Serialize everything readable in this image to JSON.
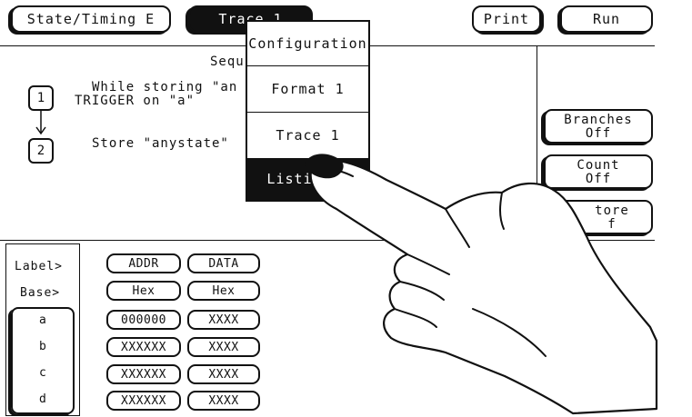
{
  "tabs": {
    "state_timing": "State/Timing E",
    "trace": "Trace 1",
    "print": "Print",
    "run": "Run"
  },
  "sequence": {
    "title": "Sequ",
    "step1_line1": "While storing \"an",
    "step1_line2": "TRIGGER on \"a\"",
    "step1_num": "1",
    "step2_line": "Store \"anystate\"",
    "step2_num": "2"
  },
  "menu": {
    "items": [
      "Configuration",
      "Format 1",
      "Trace 1",
      "Listi"
    ]
  },
  "side_buttons": {
    "branches": [
      "Branches",
      "Off"
    ],
    "count": [
      "Count",
      "Off"
    ],
    "prestore": [
      "tore",
      "f"
    ]
  },
  "table": {
    "label_header": "Label>",
    "base_header": "Base>",
    "columns": [
      {
        "label": "ADDR",
        "base": "Hex"
      },
      {
        "label": "DATA",
        "base": "Hex"
      }
    ],
    "rows": [
      {
        "name": "a",
        "addr": "000000",
        "data": "XXXX"
      },
      {
        "name": "b",
        "addr": "XXXXXX",
        "data": "XXXX"
      },
      {
        "name": "c",
        "addr": "XXXXXX",
        "data": "XXXX"
      },
      {
        "name": "d",
        "addr": "XXXXXX",
        "data": "XXXX"
      }
    ]
  }
}
